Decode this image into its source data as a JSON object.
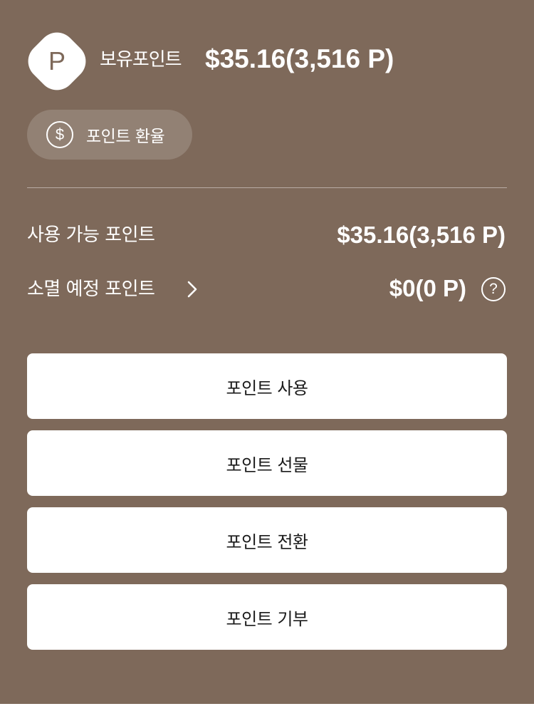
{
  "header": {
    "logo_letter": "P",
    "held_points_label": "보유포인트",
    "held_points_value": "$35.16(3,516 P)"
  },
  "exchange_rate": {
    "icon_glyph": "$",
    "label": "포인트 환율"
  },
  "rows": {
    "available": {
      "label": "사용 가능 포인트",
      "value": "$35.16(3,516 P)"
    },
    "expiring": {
      "label": "소멸 예정 포인트",
      "value": "$0(0 P)",
      "help_glyph": "?"
    }
  },
  "actions": [
    {
      "label": "포인트 사용"
    },
    {
      "label": "포인트 선물"
    },
    {
      "label": "포인트 전환"
    },
    {
      "label": "포인트 기부"
    }
  ],
  "icons": {
    "logo": "points-logo-icon",
    "exchange": "dollar-circle-icon",
    "expiring_detail": "chevron-right-icon",
    "help": "question-circle-icon"
  },
  "colors": {
    "panel_background": "#7e695a",
    "button_background": "#ffffff",
    "text_light": "#ffffff",
    "text_dark": "#1a1a1a"
  }
}
